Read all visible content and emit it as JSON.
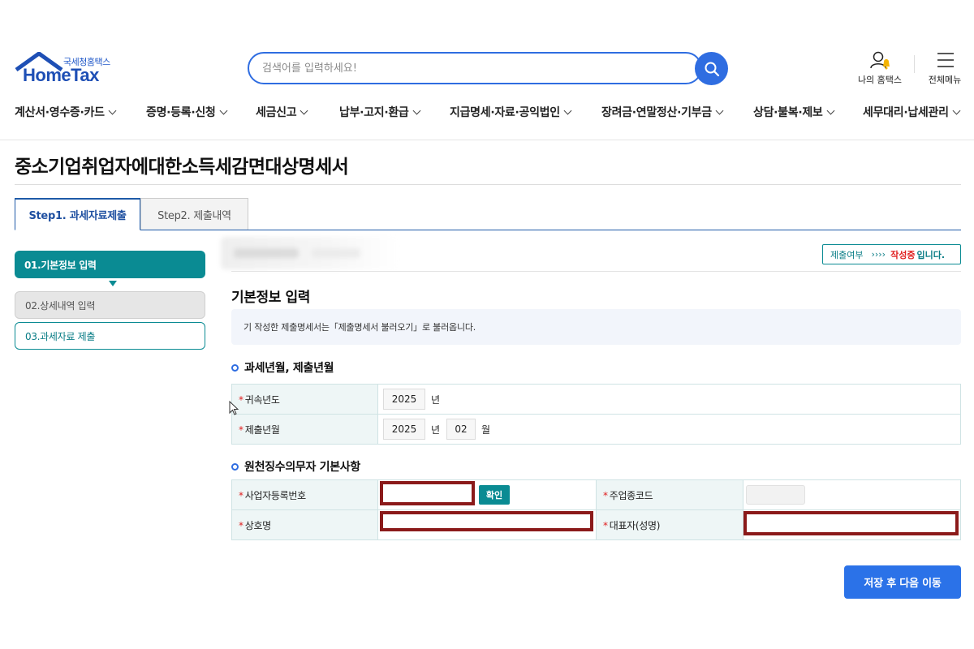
{
  "header": {
    "logo_sub": "국세청홈택스",
    "logo_main": "HomeTax",
    "search_placeholder": "검색어를 입력하세요!",
    "my_hometax": "나의 홈택스",
    "all_menu": "전체메뉴"
  },
  "nav": {
    "items": [
      "계산서·영수증·카드",
      "증명·등록·신청",
      "세금신고",
      "납부·고지·환급",
      "지급명세·자료·공익법인",
      "장려금·연말정산·기부금",
      "상담·불복·제보",
      "세무대리·납세관리"
    ]
  },
  "page": {
    "title": "중소기업취업자에대한소득세감면대상명세서"
  },
  "tabs": [
    {
      "label": "Step1. 과세자료제출",
      "active": true
    },
    {
      "label": "Step2. 제출내역",
      "active": false
    }
  ],
  "steps": [
    {
      "label": "01.기본정보 입력",
      "state": "current"
    },
    {
      "label": "02.상세내역 입력",
      "state": "disabled"
    },
    {
      "label": "03.과세자료 제출",
      "state": "pending"
    }
  ],
  "status": {
    "label": "제출여부",
    "arrows": "››››",
    "state": "작성중",
    "suffix": "입니다."
  },
  "section": {
    "title": "기본정보 입력",
    "info": "기 작성한 제출명세서는「제출명세서 불러오기」로 불러옵니다."
  },
  "period": {
    "title": "과세년월, 제출년월",
    "attribution_year_label": "귀속년도",
    "attribution_year": "2025",
    "year_unit": "년",
    "submit_label": "제출년월",
    "submit_year": "2025",
    "submit_month": "02",
    "month_unit": "월"
  },
  "withholder": {
    "title": "원천징수의무자 기본사항",
    "biz_no_label": "사업자등록번호",
    "confirm_label": "확인",
    "industry_code_label": "주업종코드",
    "company_label": "상호명",
    "rep_label": "대표자(성명)",
    "required_mark": "*"
  },
  "actions": {
    "save_next": "저장 후 다음 이동"
  },
  "colors": {
    "primary_blue": "#2b72e8",
    "teal": "#0a8b93",
    "redaction": "#8b1a1a",
    "status_red": "#e02020"
  }
}
